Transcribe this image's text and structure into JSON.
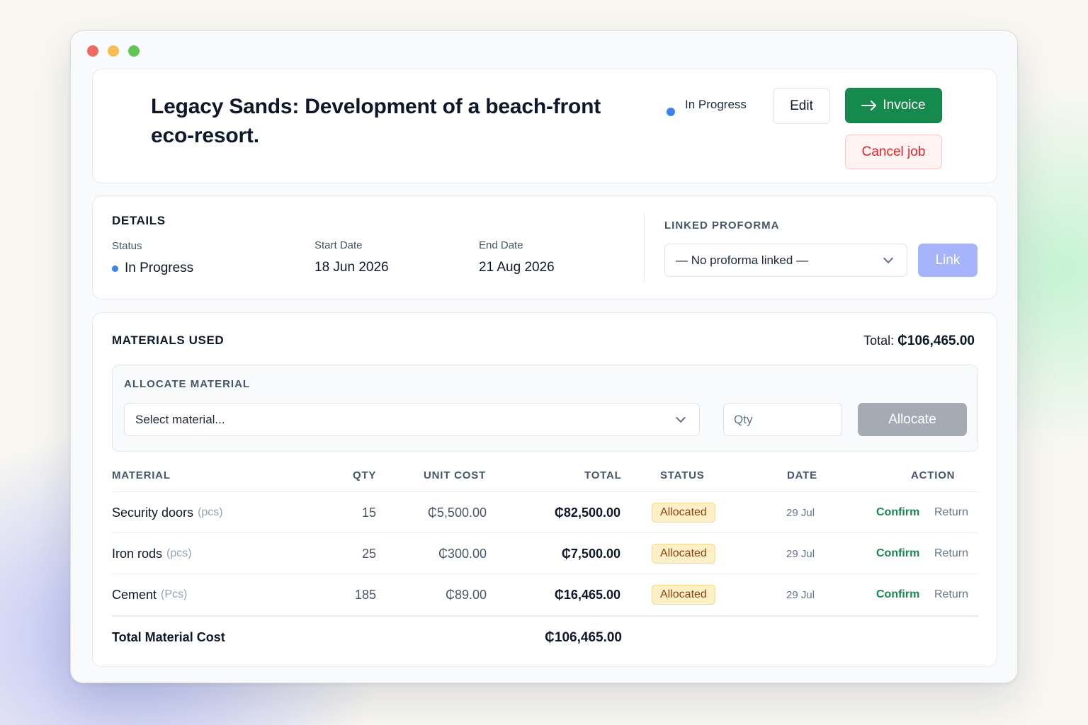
{
  "header": {
    "title": "Legacy Sands: Development of a beach-front eco-resort.",
    "status": "In Progress",
    "edit_label": "Edit",
    "invoice_label": "Invoice",
    "cancel_label": "Cancel job"
  },
  "details": {
    "section_title": "DETAILS",
    "status_label": "Status",
    "status_value": "In Progress",
    "start_label": "Start Date",
    "start_value": "18 Jun 2026",
    "end_label": "End Date",
    "end_value": "21 Aug 2026",
    "linked_title": "LINKED PROFORMA",
    "proforma_selected": "— No proforma linked —",
    "link_label": "Link"
  },
  "materials": {
    "section_title": "MATERIALS USED",
    "total_label": "Total:",
    "total_value": "₵106,465.00",
    "allocate_title": "ALLOCATE MATERIAL",
    "material_placeholder": "Select material...",
    "qty_placeholder": "Qty",
    "allocate_label": "Allocate",
    "columns": [
      "MATERIAL",
      "QTY",
      "UNIT COST",
      "TOTAL",
      "STATUS",
      "DATE",
      "ACTION"
    ],
    "rows": [
      {
        "name": "Security doors",
        "unit": "(pcs)",
        "qty": "15",
        "unit_cost": "₵5,500.00",
        "total": "₵82,500.00",
        "status": "Allocated",
        "date": "29 Jul",
        "confirm": "Confirm",
        "return": "Return"
      },
      {
        "name": "Iron rods",
        "unit": "(pcs)",
        "qty": "25",
        "unit_cost": "₵300.00",
        "total": "₵7,500.00",
        "status": "Allocated",
        "date": "29 Jul",
        "confirm": "Confirm",
        "return": "Return"
      },
      {
        "name": "Cement",
        "unit": "(Pcs)",
        "qty": "185",
        "unit_cost": "₵89.00",
        "total": "₵16,465.00",
        "status": "Allocated",
        "date": "29 Jul",
        "confirm": "Confirm",
        "return": "Return"
      }
    ],
    "footer_label": "Total Material Cost",
    "footer_value": "₵106,465.00"
  },
  "colors": {
    "primary_green": "#16894d",
    "danger_red": "#dc2626",
    "status_blue": "#3b82f6",
    "link_indigo": "#a5b4fc",
    "badge_amber": "#fdf0c7"
  }
}
